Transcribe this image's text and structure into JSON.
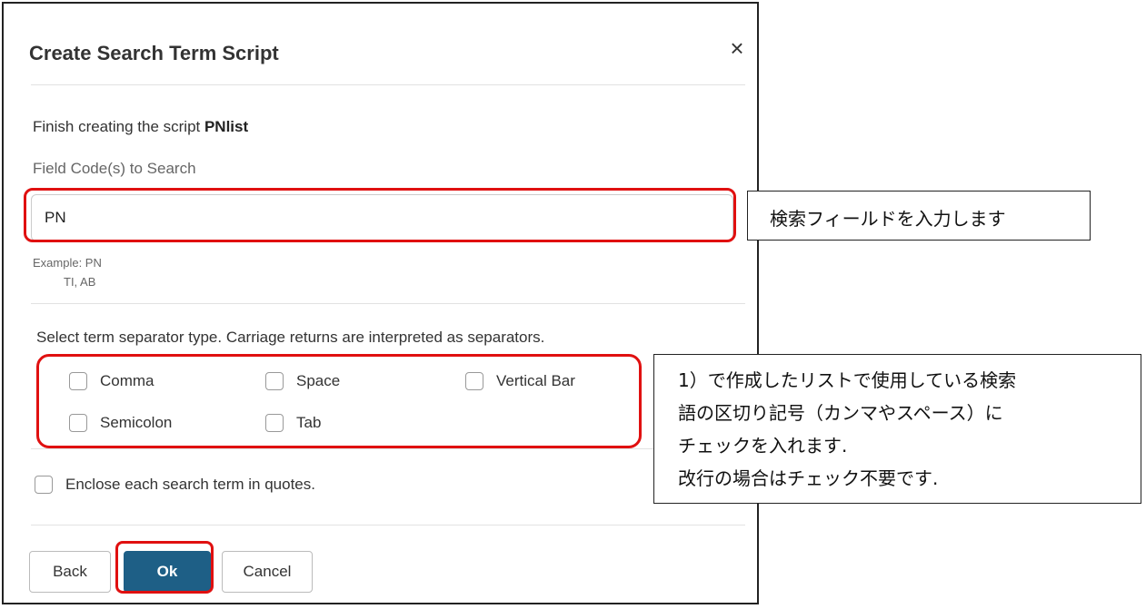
{
  "dialog": {
    "title": "Create Search Term Script",
    "close_icon": "×",
    "intro_prefix": "Finish creating the script ",
    "script_name": "PNlist",
    "field_label": "Field Code(s) to Search",
    "field_value": "PN",
    "example_label": "Example: PN",
    "example_line2": "TI, AB",
    "separator_label": "Select term separator type. Carriage returns are interpreted as separators.",
    "separators": [
      {
        "label": "Comma",
        "checked": false
      },
      {
        "label": "Space",
        "checked": false
      },
      {
        "label": "Vertical Bar",
        "checked": false
      },
      {
        "label": "Semicolon",
        "checked": false
      },
      {
        "label": "Tab",
        "checked": false
      }
    ],
    "quotes_label": "Enclose each search term in quotes.",
    "buttons": {
      "back": "Back",
      "ok": "Ok",
      "cancel": "Cancel"
    }
  },
  "annotations": {
    "field_note": "検索フィールドを入力します",
    "separator_note_1": "1）で作成したリストで使用している検索",
    "separator_note_2": "語の区切り記号（カンマやスペース）に",
    "separator_note_3": "チェックを入れます.",
    "separator_note_4": "改行の場合はチェック不要です."
  },
  "colors": {
    "highlight": "#e01010",
    "ok_button": "#1e5f86"
  }
}
